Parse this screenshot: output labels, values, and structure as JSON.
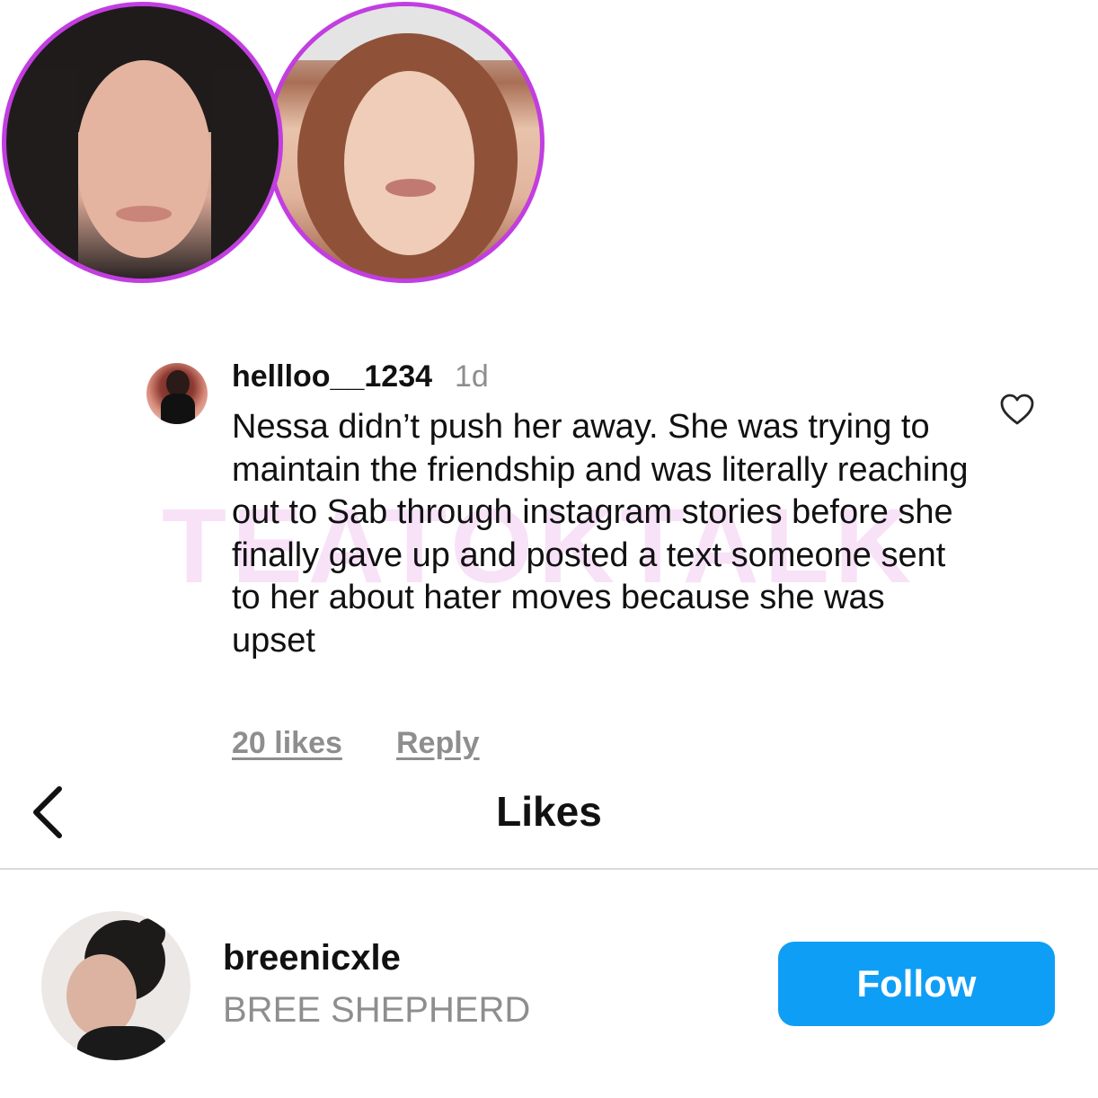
{
  "header": {
    "avatars": [
      {
        "name": "person-left-photo",
        "ring_color": "#c23ee0"
      },
      {
        "name": "person-right-photo",
        "ring_color": "#c23ee0"
      }
    ]
  },
  "watermark": {
    "text": "TEATOKTALK",
    "color": "#f6d9f6"
  },
  "comment": {
    "username": "hellloo__1234",
    "time": "1d",
    "text": "Nessa didn’t push her away. She was trying to maintain the friendship and was literally reaching out to Sab through instagram stories before she finally gave up and posted a text someone sent to her about hater moves because she was upset",
    "likes_label": "20 likes",
    "reply_label": "Reply",
    "like_icon": "heart-outline-icon"
  },
  "likes_panel": {
    "title": "Likes",
    "back_icon": "chevron-left-icon",
    "users": [
      {
        "handle": "breenicxle",
        "full_name": "BREE SHEPHERD",
        "follow_label": "Follow",
        "follow_color": "#0f9ef5"
      }
    ]
  }
}
